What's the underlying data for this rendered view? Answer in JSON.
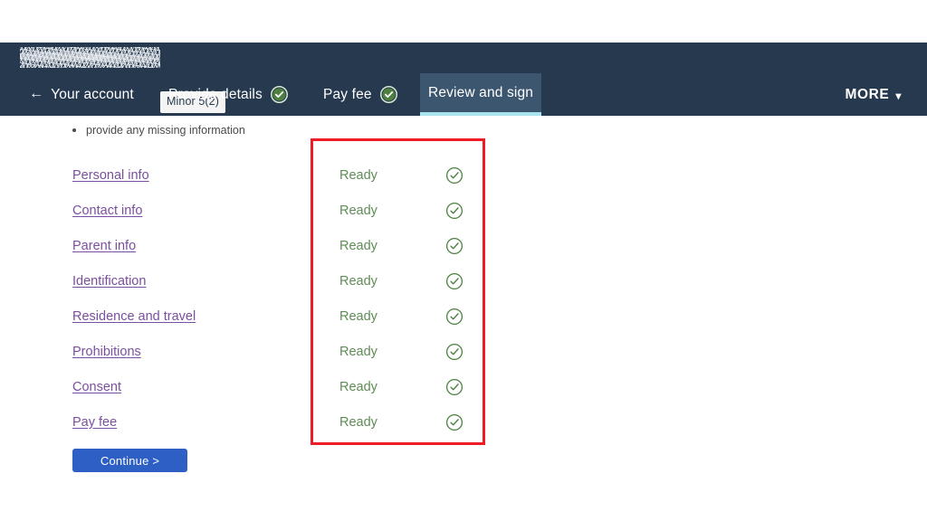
{
  "header": {
    "applicant_name_redacted": "",
    "badge": "Minor 5(2)",
    "tabs": [
      {
        "label": "Your account",
        "icon": "back-arrow-icon",
        "state": "link",
        "complete": false
      },
      {
        "label": "Provide details",
        "icon": "check-circle-filled-icon",
        "state": "default",
        "complete": true
      },
      {
        "label": "Pay fee",
        "icon": "check-circle-filled-icon",
        "state": "default",
        "complete": true
      },
      {
        "label": "Review and sign",
        "icon": "",
        "state": "active",
        "complete": false
      }
    ],
    "more_label": "MORE",
    "more_icon": "chevron-down-icon",
    "colors": {
      "bar": "#26394f",
      "active_tab": "#3c566f",
      "active_underline": "#a8e4ee"
    }
  },
  "main": {
    "bullet_text": "provide any missing information",
    "sections": [
      {
        "label": "Personal info",
        "status": "Ready",
        "status_icon": "check-circle-outline-icon"
      },
      {
        "label": "Contact info",
        "status": "Ready",
        "status_icon": "check-circle-outline-icon"
      },
      {
        "label": "Parent info",
        "status": "Ready",
        "status_icon": "check-circle-outline-icon"
      },
      {
        "label": "Identification",
        "status": "Ready",
        "status_icon": "check-circle-outline-icon"
      },
      {
        "label": "Residence and travel",
        "status": "Ready",
        "status_icon": "check-circle-outline-icon"
      },
      {
        "label": "Prohibitions",
        "status": "Ready",
        "status_icon": "check-circle-outline-icon"
      },
      {
        "label": "Consent",
        "status": "Ready",
        "status_icon": "check-circle-outline-icon"
      },
      {
        "label": "Pay fee",
        "status": "Ready",
        "status_icon": "check-circle-outline-icon"
      }
    ],
    "continue_label": "Continue >",
    "colors": {
      "link": "#7b4fa0",
      "status_text": "#5e8c55",
      "status_icon": "#4d8040",
      "button": "#2d5fc4",
      "annotation_box": "#ee1c25"
    }
  }
}
